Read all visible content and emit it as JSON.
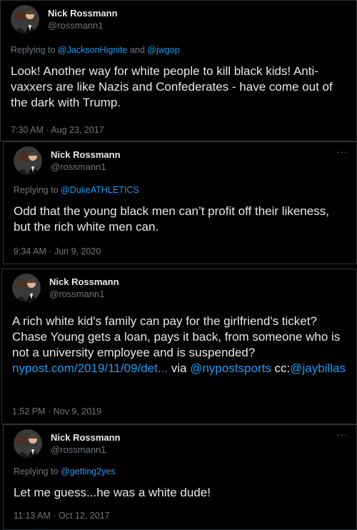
{
  "tweets": [
    {
      "name": "Nick Rossmann",
      "handle": "@rossmann1",
      "reply_prefix": "Replying to ",
      "reply_to_1": "@JacksonHignite",
      "reply_and": " and ",
      "reply_to_2": "@jwgop",
      "text": "Look! Another way for white people to kill black kids! Anti-vaxxers are like Nazis and Confederates - have come out of the dark with Trump.",
      "time": "7:30 AM · Aug 23, 2017"
    },
    {
      "name": "Nick Rossmann",
      "handle": "@rossmann1",
      "more": "···",
      "reply_prefix": "Replying to ",
      "reply_to_1": "@DukeATHLETICS",
      "text": "Odd that the young black men can’t profit off their likeness, but the rich white men can.",
      "time": "9:34 AM · Jun 9, 2020"
    },
    {
      "name": "Nick Rossmann",
      "handle": "@rossmann1",
      "text_main": "A rich white kid's family can pay for the girlfriend's ticket? Chase Young gets a loan, pays it back, from someone who is not a university employee and is suspended? ",
      "link": "nypost.com/2019/11/09/det...",
      "text_via": " via ",
      "mention_1": "@nypostsports",
      "text_cc": " cc:",
      "mention_2": "@jaybillas",
      "time": "1:52 PM · Nov 9, 2019"
    },
    {
      "name": "Nick Rossmann",
      "handle": "@rossmann1",
      "more": "···",
      "reply_prefix": "Replying to ",
      "reply_to_1": "@getting2yes",
      "text": "Let me guess...he was a white dude!",
      "time": "11:13 AM · Oct 12, 2017"
    }
  ]
}
